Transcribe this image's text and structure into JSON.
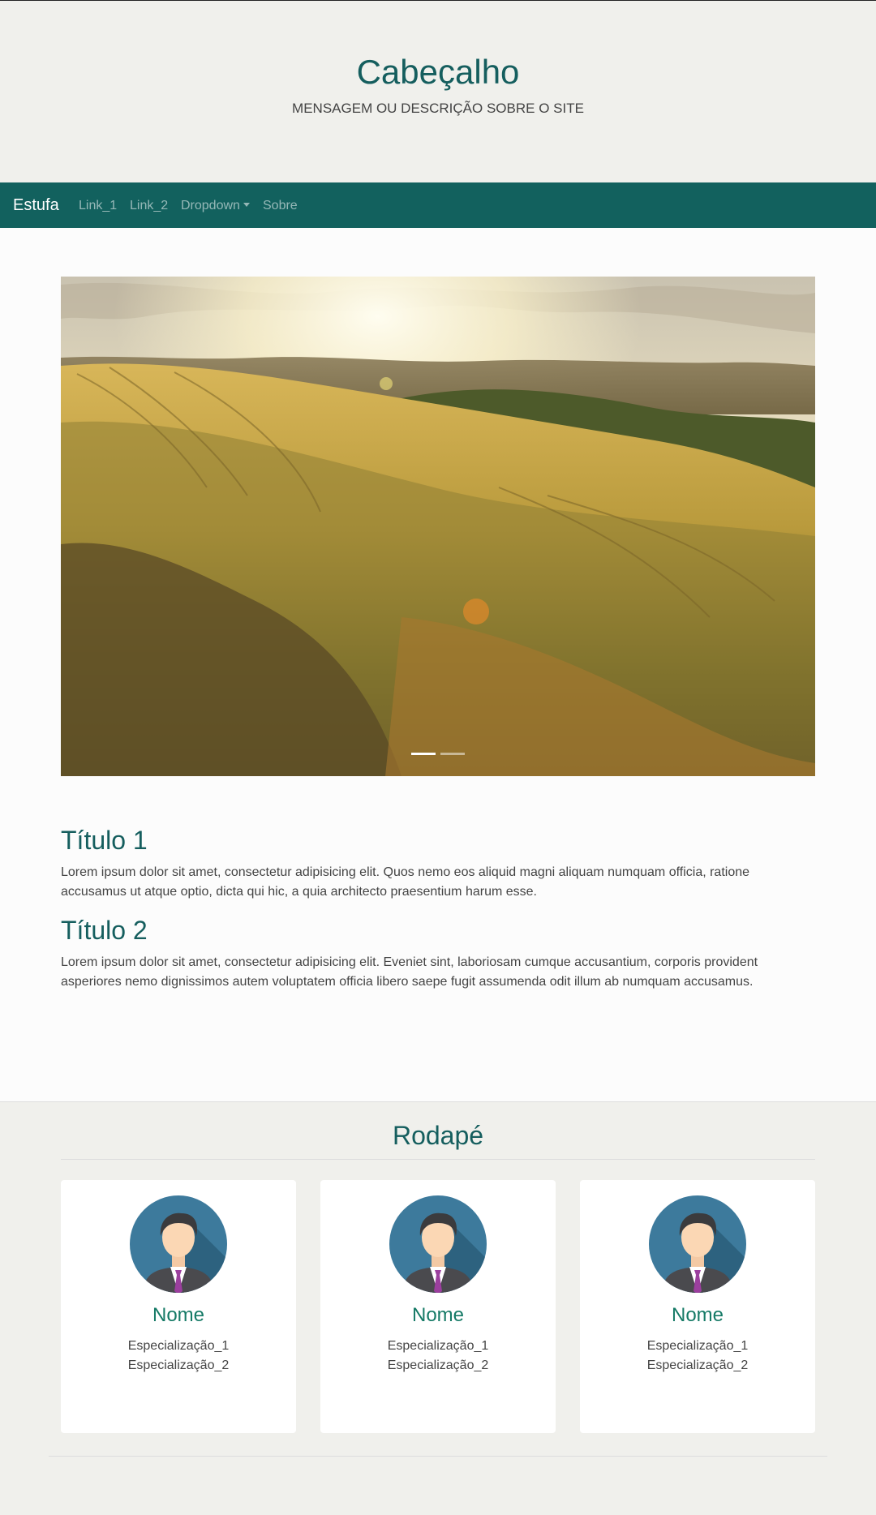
{
  "header": {
    "title": "Cabeçalho",
    "subtitle": "MENSAGEM OU DESCRIÇÃO SOBRE O SITE"
  },
  "navbar": {
    "brand": "Estufa",
    "links": [
      {
        "label": "Link_1"
      },
      {
        "label": "Link_2"
      },
      {
        "label": "Dropdown"
      },
      {
        "label": "Sobre"
      }
    ]
  },
  "carousel": {
    "slide_count": 2,
    "active_index": 0
  },
  "content": {
    "sections": [
      {
        "title": "Título 1",
        "text": "Lorem ipsum dolor sit amet, consectetur adipisicing elit. Quos nemo eos aliquid magni aliquam numquam officia, ratione accusamus ut atque optio, dicta qui hic, a quia architecto praesentium harum esse."
      },
      {
        "title": "Título 2",
        "text": "Lorem ipsum dolor sit amet, consectetur adipisicing elit. Eveniet sint, laboriosam cumque accusantium, corporis provident asperiores nemo dignissimos autem voluptatem officia libero saepe fugit assumenda odit illum ab numquam accusamus."
      }
    ]
  },
  "footer": {
    "title": "Rodapé",
    "cards": [
      {
        "name": "Nome",
        "spec_1": "Especialização_1",
        "spec_2": "Especialização_2"
      },
      {
        "name": "Nome",
        "spec_1": "Especialização_1",
        "spec_2": "Especialização_2"
      },
      {
        "name": "Nome",
        "spec_1": "Especialização_1",
        "spec_2": "Especialização_2"
      }
    ]
  },
  "colors": {
    "primary": "#155e5e",
    "navbar": "#12615e",
    "card_name": "#157a66",
    "header_bg": "#f0f0ec"
  }
}
